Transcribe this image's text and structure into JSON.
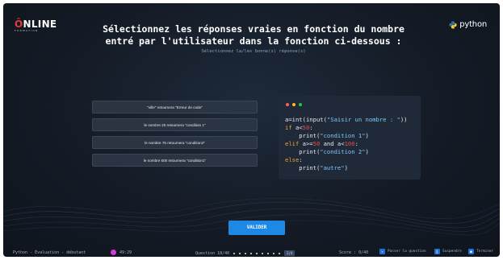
{
  "header": {
    "logo_text_main": "NLINE",
    "logo_text_o": "Ô",
    "logo_text_sub": "FORMATION",
    "brand_text": "python",
    "title": "Sélectionnez les réponses vraies en fonction du nombre entré par l'utilisateur dans la fonction ci-dessous :",
    "subtitle": "Sélectionnez la/les bonne(s) réponse(s)"
  },
  "answers": [
    {
      "label": "\"ville\" retournera \"Erreur de code\""
    },
    {
      "label": "le nombre 25 retournera \"condition 1\""
    },
    {
      "label": "le nombre 75 retournera \"condition2\""
    },
    {
      "label": "le nombre 500 retournera \"condition1\""
    }
  ],
  "code": {
    "line1_a": "a=int(input(",
    "line1_str": "\"Saisir un nombre : \"",
    "line1_b": "))",
    "line2_kw": "if",
    "line2_a": " a<",
    "line2_num": "50",
    "line2_b": ":",
    "line3_a": "    print(",
    "line3_str": "\"condition 1\"",
    "line3_b": ")",
    "line4_kw": "elif",
    "line4_a": " a>=",
    "line4_num1": "50",
    "line4_b": " and a<",
    "line4_num2": "100",
    "line4_c": ":",
    "line5_a": "    print(",
    "line5_str": "\"condition 2\"",
    "line5_b": ")",
    "line6_kw": "else",
    "line6_a": ":",
    "line7_a": "    print(",
    "line7_str": "\"autre\"",
    "line7_b": ")"
  },
  "valider_label": "VALIDER",
  "footer": {
    "course": "Python - Évaluation - débutant",
    "timer": "49:29",
    "question": "Question 18/40",
    "question_badge": "2/4",
    "score": "Score : 0/40",
    "skip": "Passer la question",
    "suspend": "Suspendre",
    "finish": "Terminer"
  },
  "colors": {
    "accent": "#1e88e5",
    "timer_dot": "#d63ad6",
    "traffic_red": "#ff5f57",
    "traffic_yellow": "#febc2e",
    "traffic_green": "#28c840"
  }
}
